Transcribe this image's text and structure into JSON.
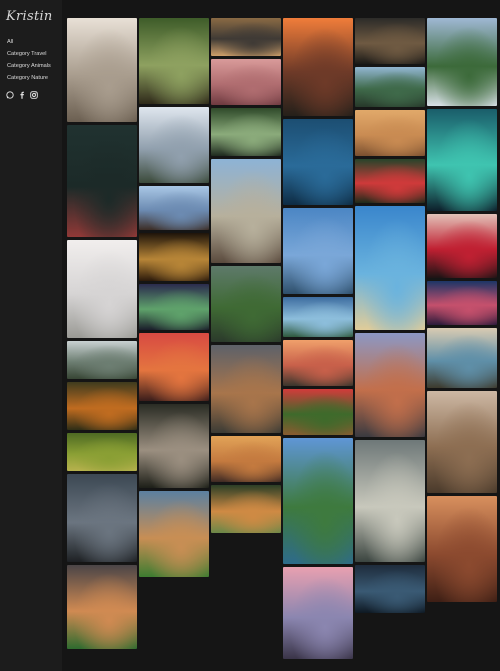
{
  "logo": {
    "text": "Kristin"
  },
  "nav": [
    "All",
    "Category Travel",
    "Category Animals",
    "Category Nature"
  ],
  "social": {
    "icons": [
      "whatsapp-icon",
      "facebook-icon",
      "instagram-icon"
    ]
  },
  "gallery": {
    "columns": [
      [
        {
          "name": "photo-hot-air-balloons-desert",
          "colors": [
            "#e8e0d6",
            "#a99d8e",
            "#6b5f51"
          ]
        },
        {
          "name": "photo-flamingos-dark",
          "colors": [
            "#203230",
            "#1c2a28",
            "#913937"
          ]
        },
        {
          "name": "photo-misty-cliff-sea",
          "colors": [
            "#f1eeed",
            "#d6d4d4",
            "#9a9a95"
          ]
        },
        {
          "name": "photo-snowy-mountain-valley",
          "colors": [
            "#c9d1d2",
            "#6d7e72",
            "#374534"
          ]
        },
        {
          "name": "photo-orange-flowers",
          "colors": [
            "#3f3b1e",
            "#c06c20",
            "#2e2d16"
          ]
        },
        {
          "name": "photo-green-hills",
          "colors": [
            "#4e6a23",
            "#8a9f34",
            "#b7b24e"
          ]
        },
        {
          "name": "photo-hiker-on-rocks",
          "colors": [
            "#3c4853",
            "#6b7580",
            "#1e2124"
          ]
        },
        {
          "name": "photo-mountain-river-sunset",
          "colors": [
            "#4b4547",
            "#d08a52",
            "#2e6b2f"
          ]
        }
      ],
      [
        {
          "name": "photo-parrot-green",
          "colors": [
            "#3e5c29",
            "#8ea160",
            "#2f2a1a"
          ]
        },
        {
          "name": "photo-waterfall",
          "colors": [
            "#dfe6ee",
            "#91a0ae",
            "#3b4a3a"
          ]
        },
        {
          "name": "photo-person-on-cliff",
          "colors": [
            "#a9c7e5",
            "#6c8bb2",
            "#3c2d25"
          ]
        },
        {
          "name": "photo-lion",
          "colors": [
            "#1e140a",
            "#b78537",
            "#2b1a0b"
          ]
        },
        {
          "name": "photo-aurora-lake",
          "colors": [
            "#2b2b4d",
            "#5fa26b",
            "#1a1d2a"
          ]
        },
        {
          "name": "photo-ship-sunset",
          "colors": [
            "#d84a42",
            "#e4753f",
            "#3a1d1b"
          ]
        },
        {
          "name": "photo-monkey",
          "colors": [
            "#2a2c24",
            "#9b8f80",
            "#1d1f18"
          ]
        },
        {
          "name": "photo-mountain-peaks",
          "colors": [
            "#5c80a0",
            "#c88e54",
            "#3d7c31"
          ]
        }
      ],
      [
        {
          "name": "photo-road-vanishing",
          "colors": [
            "#8a6a44",
            "#3f3a35",
            "#cfa06a"
          ]
        },
        {
          "name": "photo-hummingbird",
          "colors": [
            "#d99b9a",
            "#b06d70",
            "#6e3a40"
          ]
        },
        {
          "name": "photo-bridge-river",
          "colors": [
            "#2f4a2a",
            "#8bab7b",
            "#1f2a1f"
          ]
        },
        {
          "name": "photo-hiker-with-dog",
          "colors": [
            "#8db3d6",
            "#b7b09c",
            "#5a4a3d"
          ]
        },
        {
          "name": "photo-puffin",
          "colors": [
            "#5e7a6a",
            "#3f6a34",
            "#2b3a2b"
          ]
        },
        {
          "name": "photo-devils-tower",
          "colors": [
            "#5d6169",
            "#a8754b",
            "#3b3b35"
          ]
        },
        {
          "name": "photo-beach-sunset-person",
          "colors": [
            "#e2a358",
            "#c47a3f",
            "#3f2a24"
          ]
        },
        {
          "name": "photo-tiger",
          "colors": [
            "#2c3f26",
            "#cf8a44",
            "#6b8848"
          ]
        }
      ],
      [
        {
          "name": "photo-sunset-waterfall",
          "colors": [
            "#f07d3a",
            "#6e3a28",
            "#25201a"
          ]
        },
        {
          "name": "photo-pier-ocean-night",
          "colors": [
            "#1c4e72",
            "#2a6b99",
            "#0e2c44"
          ]
        },
        {
          "name": "photo-eagle-flying",
          "colors": [
            "#4b86c4",
            "#7aa7d8",
            "#2e4f6b"
          ]
        },
        {
          "name": "photo-glacier-lake",
          "colors": [
            "#3e6da0",
            "#8dbedc",
            "#2f5a3e"
          ]
        },
        {
          "name": "photo-balloons-sunrise",
          "colors": [
            "#f0a06b",
            "#c8604a",
            "#39362d"
          ]
        },
        {
          "name": "photo-squirrel-flowers",
          "colors": [
            "#d23b3b",
            "#3e6a2b",
            "#8a5b30"
          ]
        },
        {
          "name": "photo-lake-forest",
          "colors": [
            "#5f96d6",
            "#3e7a3e",
            "#2e6b8a"
          ]
        },
        {
          "name": "photo-temple-gate",
          "colors": [
            "#e8a0b0",
            "#8b86b0",
            "#3a3448"
          ]
        }
      ],
      [
        {
          "name": "photo-deer-antlers",
          "colors": [
            "#2c2b28",
            "#6f5a42",
            "#1a1917"
          ]
        },
        {
          "name": "photo-pine-mountains",
          "colors": [
            "#92b6d2",
            "#3f6a4a",
            "#27382a"
          ]
        },
        {
          "name": "photo-pyramids-camels",
          "colors": [
            "#e1a96a",
            "#c98b52",
            "#7a5030"
          ]
        },
        {
          "name": "photo-red-parrot",
          "colors": [
            "#27442a",
            "#cf3a3a",
            "#1e2b1a"
          ]
        },
        {
          "name": "photo-palm-beach",
          "colors": [
            "#3a86cc",
            "#6ab3de",
            "#e0cc99"
          ]
        },
        {
          "name": "photo-person-balloons",
          "colors": [
            "#8c98c4",
            "#c26f4b",
            "#3a3a40"
          ]
        },
        {
          "name": "photo-forest-sunbeams",
          "colors": [
            "#6e7878",
            "#c8c8bc",
            "#3b4540"
          ]
        },
        {
          "name": "photo-tent-night",
          "colors": [
            "#1e2c3c",
            "#3a5a74",
            "#0e1822"
          ]
        }
      ],
      [
        {
          "name": "photo-pine-forest-peaks",
          "colors": [
            "#9fb8d4",
            "#3c6a3a",
            "#d8e0e6"
          ]
        },
        {
          "name": "photo-aurora-person",
          "colors": [
            "#1a5d6a",
            "#3fc4b0",
            "#0d1f2b"
          ]
        },
        {
          "name": "photo-red-lips",
          "colors": [
            "#e2c2b8",
            "#c02032",
            "#1c1415"
          ]
        },
        {
          "name": "photo-balloon-sky",
          "colors": [
            "#1d3566",
            "#c5506c",
            "#2a1a3a"
          ]
        },
        {
          "name": "photo-waterfall-sunset",
          "colors": [
            "#d9cbb2",
            "#5f8fa8",
            "#3d3a2d"
          ]
        },
        {
          "name": "photo-rock-formation",
          "colors": [
            "#cdb8a4",
            "#8d6e52",
            "#4a3a2b"
          ]
        },
        {
          "name": "photo-canyon-person",
          "colors": [
            "#d8905e",
            "#8c4a2f",
            "#3e1f15"
          ]
        }
      ]
    ]
  }
}
